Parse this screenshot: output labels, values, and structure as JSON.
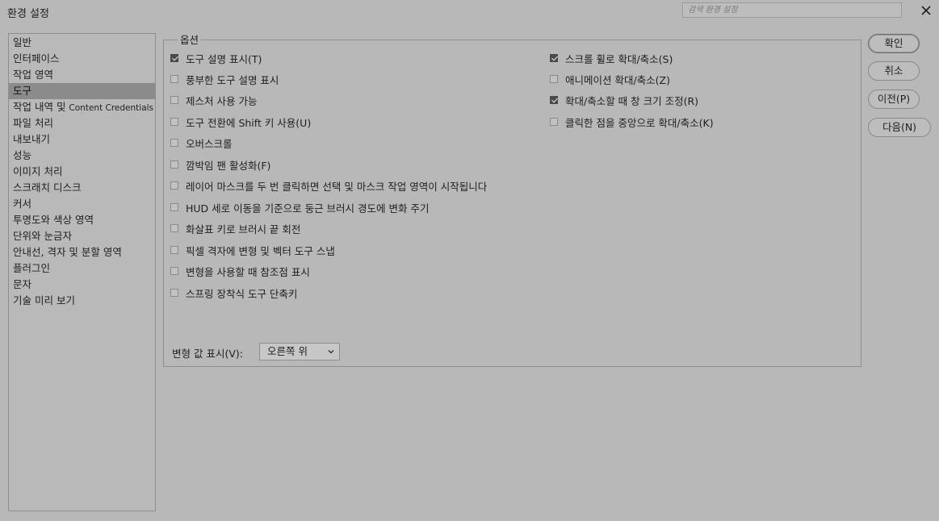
{
  "window": {
    "title": "환경 설정",
    "search_placeholder": "검색 환경 설정"
  },
  "sidebar": {
    "items": [
      {
        "label": "일반"
      },
      {
        "label": "인터페이스"
      },
      {
        "label": "작업 영역"
      },
      {
        "label": "도구",
        "selected": true
      },
      {
        "label": "작업 내역 및 ",
        "label_small": "Content Credentials"
      },
      {
        "label": "파일 처리"
      },
      {
        "label": "내보내기"
      },
      {
        "label": "성능"
      },
      {
        "label": "이미지 처리"
      },
      {
        "label": "스크래치 디스크"
      },
      {
        "label": "커서"
      },
      {
        "label": "투명도와 색상 영역"
      },
      {
        "label": "단위와 눈금자"
      },
      {
        "label": "안내선, 격자 및 분할 영역"
      },
      {
        "label": "플러그인"
      },
      {
        "label": "문자"
      },
      {
        "label": "기술 미리 보기"
      }
    ]
  },
  "options": {
    "legend": "옵션",
    "left": [
      {
        "label": "도구 설명 표시(T)",
        "checked": true
      },
      {
        "label": "풍부한 도구 설명 표시",
        "checked": false
      },
      {
        "label": "제스처 사용 가능",
        "checked": false
      },
      {
        "label": "도구 전환에 Shift 키 사용(U)",
        "checked": false
      },
      {
        "label": "오버스크롤",
        "checked": false
      },
      {
        "label": "깜박임 팬 활성화(F)",
        "checked": false
      },
      {
        "label": "레이어 마스크를 두 번 클릭하면 선택 및 마스크 작업 영역이 시작됩니다",
        "checked": false
      },
      {
        "label": "HUD 세로 이동을 기준으로 둥근 브러시 경도에 변화 주기",
        "checked": false
      },
      {
        "label": "화살표 키로 브러시 끝 회전",
        "checked": false
      },
      {
        "label": "픽셀 격자에 변형 및 벡터 도구 스냅",
        "checked": false
      },
      {
        "label": "변형을 사용할 때 참조점 표시",
        "checked": false
      },
      {
        "label": "스프링 장착식 도구 단축키",
        "checked": false
      }
    ],
    "right": [
      {
        "label": "스크롤 휠로 확대/축소(S)",
        "checked": true
      },
      {
        "label": "애니메이션 확대/축소(Z)",
        "checked": false
      },
      {
        "label": "확대/축소할 때 창 크기 조정(R)",
        "checked": true
      },
      {
        "label": "클릭한 점을 중앙으로 확대/축소(K)",
        "checked": false
      }
    ],
    "transform_values": {
      "label": "변형 값 표시(V):",
      "value": "오른쪽 위"
    }
  },
  "buttons": {
    "ok": "확인",
    "cancel": "취소",
    "prev": "이전(P)",
    "next": "다음(N)"
  },
  "colors": {
    "background": "#b8b8b8",
    "selected_row": "#8b8b8b",
    "checkbox_checked": "#4a4a4a"
  }
}
